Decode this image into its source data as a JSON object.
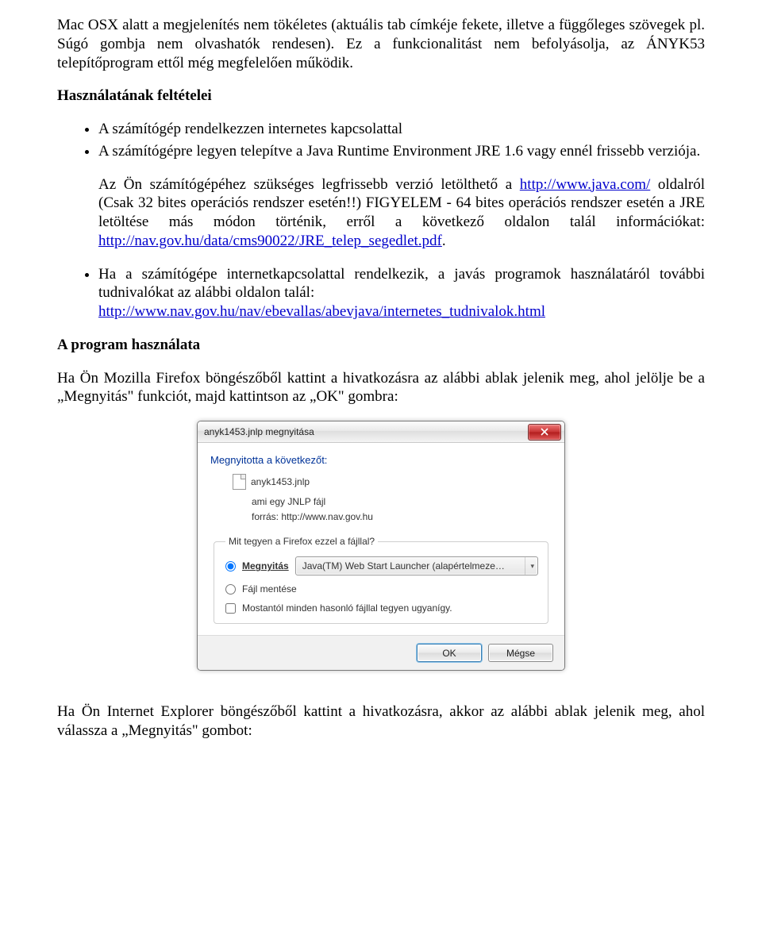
{
  "intro_paragraph": "Mac OSX alatt a megjelenítés nem tökéletes (aktuális tab címkéje fekete, illetve a függőleges szövegek pl. Súgó gombja nem olvashatók rendesen). Ez a funkcionalitást nem befolyásolja, az ÁNYK53 telepítőprogram ettől még megfelelően működik.",
  "conditions_heading": "Használatának feltételei",
  "bullets1": [
    "A számítógép rendelkezzen internetes kapcsolattal",
    "A számítógépre legyen telepítve a Java Runtime Environment JRE 1.6 vagy ennél frissebb verziója."
  ],
  "para2_before_link": "Az Ön számítógépéhez szükséges legfrissebb verzió letölthető a ",
  "para2_link1": "http://www.java.com/",
  "para2_mid": " oldalról (Csak 32 bites operációs rendszer esetén!!) FIGYELEM - 64 bites operációs rendszer esetén a JRE letöltése más módon történik, erről a következő oldalon talál információkat: ",
  "para2_link2": "http://nav.gov.hu/data/cms90022/JRE_telep_segedlet.pdf",
  "para2_end": ".",
  "bullet3_text": "Ha a számítógépe internetkapcsolattal rendelkezik, a javás programok használatáról további tudnivalókat az alábbi oldalon talál:",
  "bullet3_link": "http://www.nav.gov.hu/nav/ebevallas/abevjava/internetes_tudnivalok.html",
  "usage_heading": "A program használata",
  "para_firefox": "Ha Ön Mozilla Firefox böngészőből kattint a hivatkozásra az alábbi ablak jelenik meg, ahol jelölje be a „Megnyitás\" funkciót, majd kattintson az „OK\" gombra:",
  "dialog": {
    "title": "anyk1453.jnlp megnyitása",
    "opened_heading": "Megnyitotta a következőt:",
    "filename": "anyk1453.jnlp",
    "type_label": "ami egy",
    "type_value": "JNLP fájl",
    "source_label": "forrás:",
    "source_value": "http://www.nav.gov.hu",
    "group_legend": "Mit tegyen a Firefox ezzel a fájllal?",
    "open_label": "Megnyitás",
    "app_text": "Java(TM) Web Start Launcher (alapértelmeze…",
    "save_label": "Fájl mentése",
    "remember_label": "Mostantól minden hasonló fájllal tegyen ugyanígy.",
    "ok": "OK",
    "cancel": "Mégse"
  },
  "para_ie": "Ha Ön Internet Explorer böngészőből kattint a hivatkozásra, akkor az alábbi ablak jelenik meg, ahol válassza a „Megnyitás\" gombot:"
}
